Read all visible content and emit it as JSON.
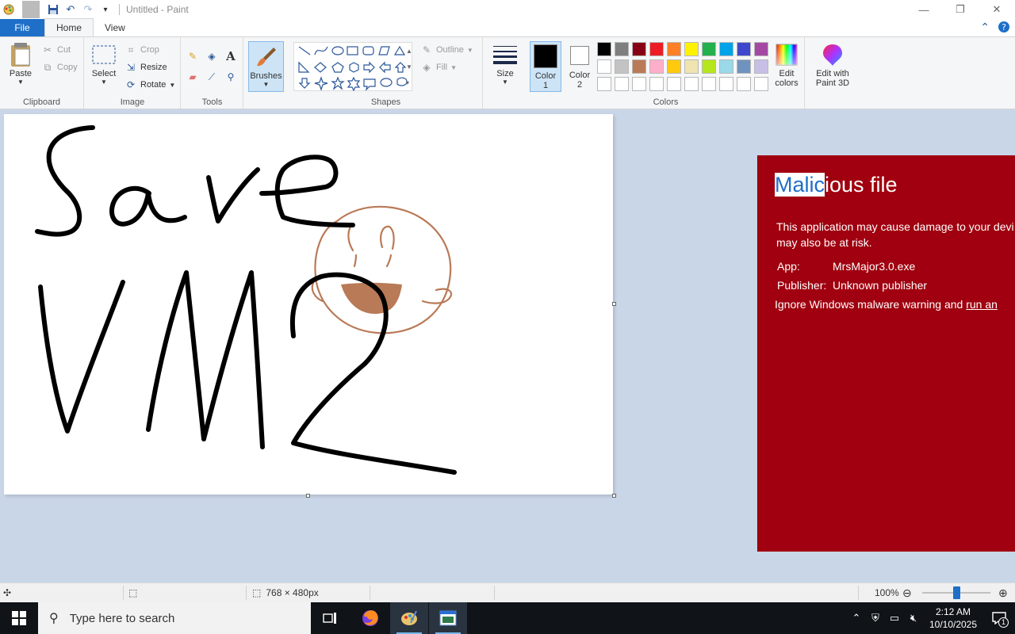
{
  "window": {
    "title": "Untitled - Paint",
    "minimize_icon": "minimize-icon",
    "maximize_icon": "restore-icon",
    "close_icon": "close-icon"
  },
  "tabs": [
    {
      "label": "File"
    },
    {
      "label": "Home"
    },
    {
      "label": "View"
    }
  ],
  "ribbon": {
    "clipboard": {
      "label": "Clipboard",
      "paste": "Paste",
      "cut": "Cut",
      "copy": "Copy"
    },
    "image": {
      "label": "Image",
      "select": "Select",
      "crop": "Crop",
      "resize": "Resize",
      "rotate": "Rotate"
    },
    "tools": {
      "label": "Tools"
    },
    "brushes": {
      "label": "Brushes"
    },
    "shapes": {
      "label": "Shapes",
      "outline": "Outline",
      "fill": "Fill"
    },
    "size": {
      "label": "Size"
    },
    "colors": {
      "label": "Colors",
      "color1": "Color",
      "color1_num": "1",
      "color2": "Color",
      "color2_num": "2",
      "edit_colors_1": "Edit",
      "edit_colors_2": "colors",
      "edit_3d_1": "Edit with",
      "edit_3d_2": "Paint 3D",
      "palette_row1": [
        "#000000",
        "#7f7f7f",
        "#880015",
        "#ed1c24",
        "#ff7f27",
        "#fff200",
        "#22b14c",
        "#00a2e8",
        "#3f48cc",
        "#a349a4"
      ],
      "palette_row2": [
        "#ffffff",
        "#c3c3c3",
        "#b97a57",
        "#ffaec9",
        "#ffc90e",
        "#efe4b0",
        "#b5e61d",
        "#99d9ea",
        "#7092be",
        "#c8bfe7"
      ],
      "palette_row3": [
        "#ffffff",
        "#ffffff",
        "#ffffff",
        "#ffffff",
        "#ffffff",
        "#ffffff",
        "#ffffff",
        "#ffffff",
        "#ffffff",
        "#ffffff"
      ]
    }
  },
  "warning": {
    "title_highlight": "Malic",
    "title_rest": "ious file",
    "body_line1": "This application may cause damage to your devi",
    "body_line2": "may also be at risk.",
    "app_key": "App:",
    "app_value": "MrsMajor3.0.exe",
    "publisher_key": "Publisher:",
    "publisher_value": "Unknown publisher",
    "ignore_text": "Ignore Windows malware warning and ",
    "ignore_link": "run an",
    "bg_color": "#a0000f"
  },
  "status": {
    "image_size": "768 × 480px",
    "zoom": "100%",
    "zoom_fraction": 0.5
  },
  "taskbar": {
    "search_placeholder": "Type here to search",
    "time": "2:12 AM",
    "date": "10/10/2025",
    "notification_count": "1"
  }
}
